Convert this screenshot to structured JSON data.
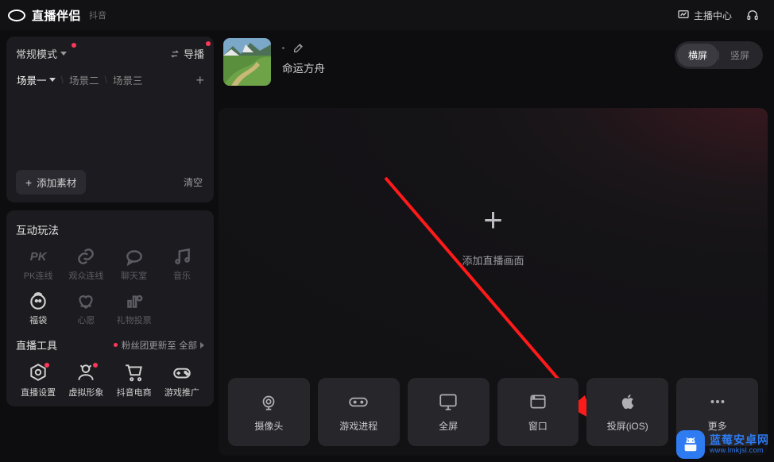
{
  "header": {
    "app_name": "直播伴侣",
    "sub": "抖音",
    "host_center": "主播中心"
  },
  "sidebar": {
    "mode": {
      "label": "常规模式"
    },
    "director": "导播",
    "scenes": [
      "场景一",
      "场景二",
      "场景三"
    ],
    "add_source": "添加素材",
    "clear": "清空",
    "section_interact": "互动玩法",
    "widgets_row1": [
      {
        "label": "PK连线"
      },
      {
        "label": "观众连线"
      },
      {
        "label": "聊天室"
      },
      {
        "label": "音乐"
      }
    ],
    "widgets_row2": [
      {
        "label": "福袋"
      },
      {
        "label": "心愿"
      },
      {
        "label": "礼物投票"
      }
    ],
    "section_tools": "直播工具",
    "tools_sub": "粉丝团更新至 全部",
    "tools": [
      {
        "label": "直播设置"
      },
      {
        "label": "虚拟形象"
      },
      {
        "label": "抖音电商"
      },
      {
        "label": "游戏推广"
      }
    ]
  },
  "main": {
    "stream_name": "命运方舟",
    "orient_h": "横屏",
    "orient_v": "竖屏",
    "add_canvas": "添加直播画面",
    "sources": [
      "摄像头",
      "游戏进程",
      "全屏",
      "窗口",
      "投屏(iOS)",
      "更多"
    ]
  },
  "watermark": {
    "line1": "蓝莓安卓网",
    "line2": "www.lmkjsl.com"
  }
}
